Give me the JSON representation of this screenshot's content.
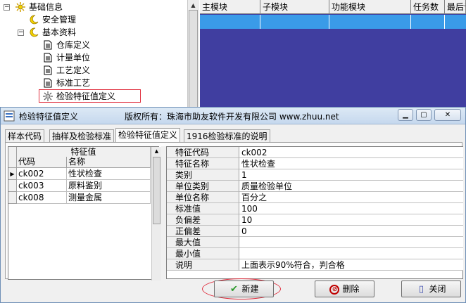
{
  "tree": {
    "items": [
      {
        "label": "基础信息",
        "expander": "⊟",
        "icon": "gear-icon"
      },
      {
        "label": "安全管理",
        "icon": "moon-icon"
      },
      {
        "label": "基本资料",
        "expander": "⊟",
        "icon": "moon-icon"
      },
      {
        "label": "仓库定义",
        "icon": "document-icon"
      },
      {
        "label": "计量单位",
        "icon": "document-icon"
      },
      {
        "label": "工艺定义",
        "icon": "document-icon"
      },
      {
        "label": "标准工艺",
        "icon": "document-icon"
      },
      {
        "label": "检验特征值定义",
        "icon": "gear-icon",
        "highlighted": true
      }
    ]
  },
  "module_grid": {
    "columns": [
      "主模块",
      "子模块",
      "功能模块",
      "任务数",
      "最后访"
    ]
  },
  "window": {
    "title": "检验特征值定义",
    "copyright": "版权所有：珠海市助友软件开发有限公司 www.zhuu.net",
    "controls": [
      "minimize-icon",
      "maximize-icon",
      "close-icon"
    ]
  },
  "tabs": [
    "样本代码",
    "抽样及检验标准",
    "检验特征值定义",
    "1916检验标准的说明"
  ],
  "active_tab": 2,
  "left_grid": {
    "group_header": "特征值",
    "col_code": "代码",
    "col_name": "名称",
    "rows": [
      {
        "code": "ck002",
        "name": "性状检查",
        "current": true
      },
      {
        "code": "ck003",
        "name": "原料鉴别"
      },
      {
        "code": "ck008",
        "name": "测量金属"
      }
    ]
  },
  "detail": {
    "fields": [
      {
        "label": "特征代码",
        "value": "ck002"
      },
      {
        "label": "特征名称",
        "value": "性状检查"
      },
      {
        "label": "类别",
        "value": "1"
      },
      {
        "label": "单位类别",
        "value": "质量检验单位"
      },
      {
        "label": "单位名称",
        "value": "百分之"
      },
      {
        "label": "标准值",
        "value": "100"
      },
      {
        "label": "负偏差",
        "value": "10"
      },
      {
        "label": "正偏差",
        "value": "0"
      },
      {
        "label": "最大值",
        "value": ""
      },
      {
        "label": "最小值",
        "value": ""
      },
      {
        "label": "说明",
        "value": "上面表示90%符合，判合格"
      }
    ]
  },
  "buttons": {
    "new_label": "新建",
    "delete_label": "删除",
    "close_label": "关闭"
  },
  "colors": {
    "grid_background": "#403ea0",
    "selected_cell": "#3a9be8",
    "highlight_outline": "#e0303f"
  }
}
